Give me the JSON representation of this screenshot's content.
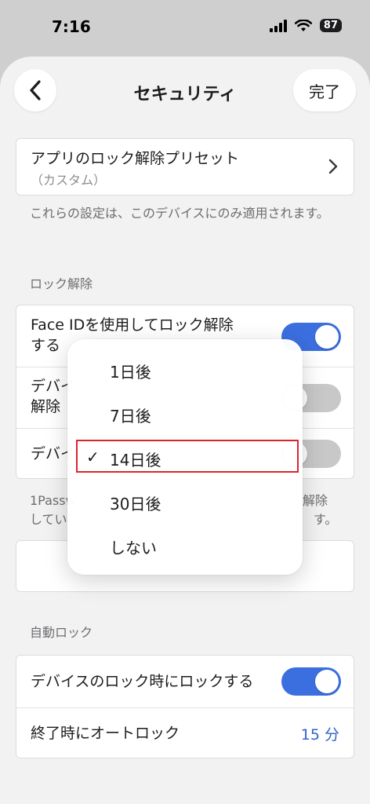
{
  "status_bar": {
    "time": "7:16",
    "battery": "87"
  },
  "nav": {
    "title": "セキュリティ",
    "done": "完了"
  },
  "preset": {
    "title": "アプリのロック解除プリセット",
    "subtitle": "（カスタム）"
  },
  "device_note": "これらの設定は、このデバイスにのみ適用されます。",
  "unlock_section": {
    "header": "ロック解除",
    "rows": [
      {
        "label_line1": "Face IDを使用してロック解除",
        "label_line2": "する",
        "toggle": true
      },
      {
        "label_line1": "デバイ",
        "label_line2": "解除",
        "toggle": false
      },
      {
        "label_line1": "デバイ",
        "toggle": false
      }
    ],
    "note_line1_start": "1Passw",
    "note_line1_end": "解除",
    "note_line2_start": "してい",
    "note_line2_end": "す。"
  },
  "popup_menu": {
    "items": [
      "1日後",
      "7日後",
      "14日後",
      "30日後",
      "しない"
    ],
    "selected": "14日後",
    "check": "✓"
  },
  "autolock_section": {
    "header": "自動ロック",
    "lock_on_device_lock": {
      "label": "デバイスのロック時にロックする",
      "toggle": true
    },
    "autolock_on_quit": {
      "label": "終了時にオートロック",
      "value": "15 分"
    }
  },
  "colors": {
    "accent": "#3b6fe0",
    "highlight": "#d9262e",
    "link": "#2f63c9"
  }
}
